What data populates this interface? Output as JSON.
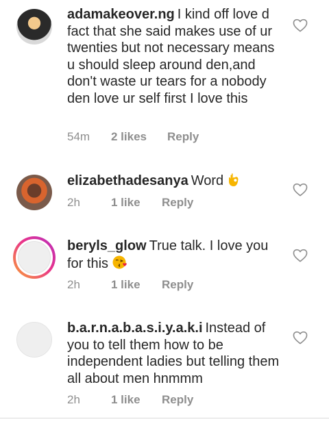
{
  "comments": [
    {
      "username": "adamakeover.ng",
      "text": "I kind off love d fact that she said makes use of ur twenties but not necessary means u should sleep around den,and don't waste ur tears for a nobody den love ur self first I love this",
      "time": "54m",
      "likes": "2 likes",
      "reply": "Reply"
    },
    {
      "username": "elizabethadesanya",
      "text": "Word",
      "emoji": "ok-hand",
      "time": "2h",
      "likes": "1 like",
      "reply": "Reply"
    },
    {
      "username": "beryls_glow",
      "text": "True talk. I love you for this",
      "emoji": "kissing-heart",
      "time": "2h",
      "likes": "1 like",
      "reply": "Reply"
    },
    {
      "username": "b.a.r.n.a.b.a.s.i.y.a.k.i",
      "text": "Instead of you to tell them how to be independent ladies but telling them all about men hnmmm",
      "time": "2h",
      "likes": "1 like",
      "reply": "Reply"
    }
  ],
  "icons": {
    "like": "heart-outline-icon"
  },
  "colors": {
    "meta": "#8e8e8e",
    "text": "#262626",
    "story_ring_start": "#f9a234",
    "story_ring_end": "#b62fbf"
  }
}
